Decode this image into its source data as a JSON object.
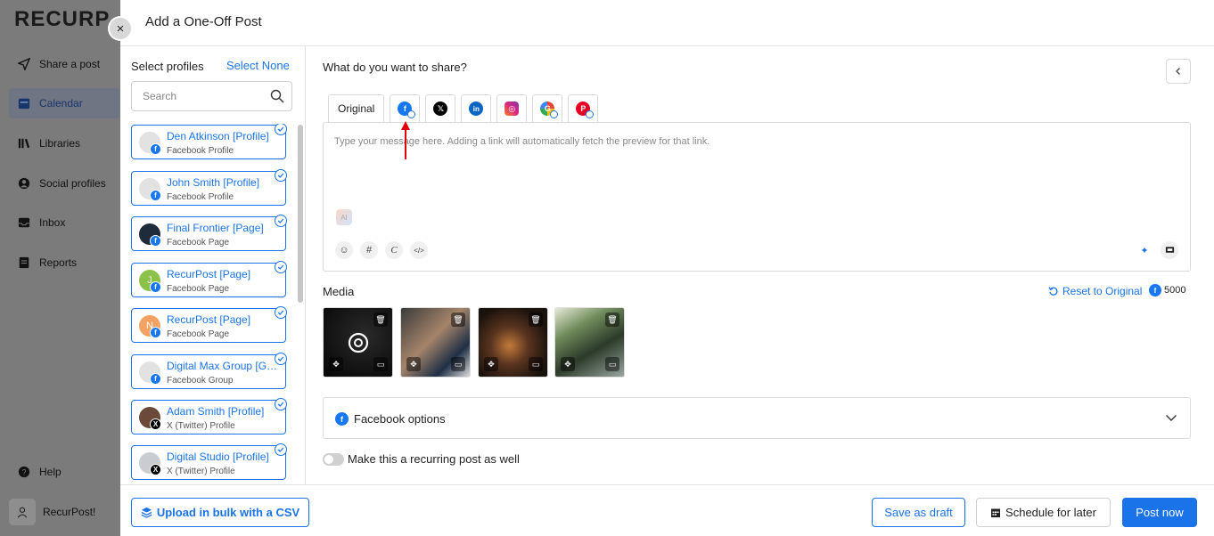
{
  "app": {
    "logo": "RECURP",
    "nav": [
      {
        "label": "Share a post",
        "icon": "send-icon"
      },
      {
        "label": "Calendar",
        "icon": "calendar-icon"
      },
      {
        "label": "Libraries",
        "icon": "library-icon"
      },
      {
        "label": "Social profiles",
        "icon": "profile-icon"
      },
      {
        "label": "Inbox",
        "icon": "inbox-icon"
      },
      {
        "label": "Reports",
        "icon": "report-icon"
      }
    ],
    "help": "Help",
    "user": "RecurPost!"
  },
  "modal": {
    "title": "Add a One-Off Post",
    "close": "×"
  },
  "profiles": {
    "heading": "Select profiles",
    "select_none": "Select None",
    "search_placeholder": "Search",
    "items": [
      {
        "name": "Den Atkinson [Profile]",
        "type": "Facebook Profile",
        "network": "facebook"
      },
      {
        "name": "John Smith [Profile]",
        "type": "Facebook Profile",
        "network": "facebook"
      },
      {
        "name": "Final Frontier [Page]",
        "type": "Facebook Page",
        "network": "facebook"
      },
      {
        "name": "RecurPost [Page]",
        "type": "Facebook Page",
        "network": "facebook",
        "initial": "J"
      },
      {
        "name": "RecurPost [Page]",
        "type": "Facebook Page",
        "network": "facebook",
        "initial": "N"
      },
      {
        "name": "Digital Max Group [Group]",
        "type": "Facebook Group",
        "network": "facebook"
      },
      {
        "name": "Adam Smith [Profile]",
        "type": "X (Twitter) Profile",
        "network": "x"
      },
      {
        "name": "Digital Studio [Profile]",
        "type": "X (Twitter) Profile",
        "network": "x"
      }
    ]
  },
  "compose": {
    "question": "What do you want to share?",
    "tab_original": "Original",
    "tabs": [
      {
        "icon": "facebook-icon",
        "letter": "f"
      },
      {
        "icon": "x-icon",
        "letter": "𝕏"
      },
      {
        "icon": "linkedin-icon",
        "letter": "in"
      },
      {
        "icon": "instagram-icon",
        "letter": "◎"
      },
      {
        "icon": "google-business-icon",
        "letter": "G"
      },
      {
        "icon": "pinterest-icon",
        "letter": "P"
      }
    ],
    "placeholder": "Type your message here. Adding a link will automatically fetch the preview for that link.",
    "ai_chip": "AI"
  },
  "media": {
    "label": "Media",
    "reset": "Reset to Original",
    "char_count": "5000"
  },
  "facebook_options": "Facebook options",
  "recurring": "Make this a recurring post as well",
  "footer": {
    "upload_csv": "Upload in bulk with a CSV",
    "save_draft": "Save as draft",
    "schedule": "Schedule for later",
    "post_now": "Post now"
  },
  "colors": {
    "accent": "#1a73e8",
    "facebook": "#1877f2",
    "x": "#000000",
    "linkedin": "#0a66c2",
    "instagram": "#e1306c",
    "pinterest": "#e60023",
    "annotation_arrow": "#e00000"
  }
}
